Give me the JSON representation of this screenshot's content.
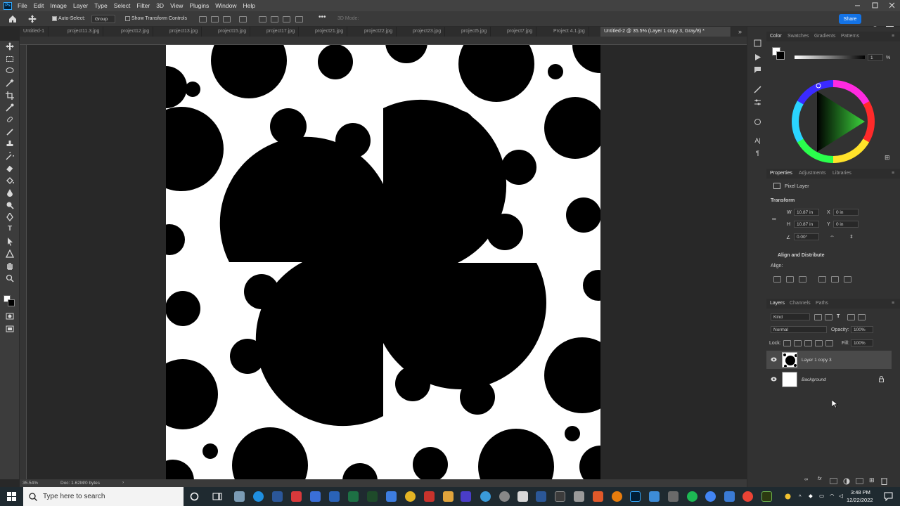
{
  "menubar": {
    "items": [
      "File",
      "Edit",
      "Image",
      "Layer",
      "Type",
      "Select",
      "Filter",
      "3D",
      "View",
      "Plugins",
      "Window",
      "Help"
    ]
  },
  "options": {
    "auto_select_label": "Auto-Select:",
    "group_value": "Group",
    "show_transform_label": "Show Transform Controls",
    "mode_3d_label": "3D Mode:",
    "share_label": "Share"
  },
  "tabs": [
    {
      "label": "Untitled-1"
    },
    {
      "label": "project11.3.jpg"
    },
    {
      "label": "project12.jpg"
    },
    {
      "label": "project13.jpg"
    },
    {
      "label": "project15.jpg"
    },
    {
      "label": "project17.jpg"
    },
    {
      "label": "project21.jpg"
    },
    {
      "label": "project22.jpg"
    },
    {
      "label": "project23.jpg"
    },
    {
      "label": "project5.jpg"
    },
    {
      "label": "project7.jpg"
    },
    {
      "label": "Project 4.1.jpg"
    },
    {
      "label": "Untitled-2 @ 35.5% (Layer 1 copy 3, Gray/8) *",
      "active": true
    }
  ],
  "status": {
    "zoom": "35.54%",
    "doc": "Doc: 1.62M/0 bytes"
  },
  "color_panel": {
    "tabs": [
      "Color",
      "Swatches",
      "Gradients",
      "Patterns"
    ],
    "value": "1",
    "unit": "%"
  },
  "properties_panel": {
    "tabs": [
      "Properties",
      "Adjustments",
      "Libraries"
    ],
    "type_label": "Pixel Layer",
    "transform_label": "Transform",
    "w_label": "W",
    "w_value": "10.87 in",
    "h_label": "H",
    "h_value": "10.87 in",
    "x_label": "X",
    "x_value": "0 in",
    "y_label": "Y",
    "y_value": "0 in",
    "angle_value": "0.00°",
    "align_label": "Align and Distribute",
    "align_sub": "Align:"
  },
  "layers_panel": {
    "tabs": [
      "Layers",
      "Channels",
      "Paths"
    ],
    "kind_label": "Kind",
    "blend_mode": "Normal",
    "opacity_label": "Opacity:",
    "opacity_value": "100%",
    "lock_label": "Lock:",
    "fill_label": "Fill:",
    "fill_value": "100%",
    "layers": [
      {
        "name": "Layer 1 copy 3",
        "selected": true
      },
      {
        "name": "Background",
        "locked": true
      }
    ]
  },
  "taskbar": {
    "search_placeholder": "Type here to search",
    "time": "3:48 PM",
    "date": "12/22/2022"
  },
  "colors": {
    "accent": "#1473e6",
    "canvas_bg": "#ffffff",
    "shape": "#000000"
  }
}
